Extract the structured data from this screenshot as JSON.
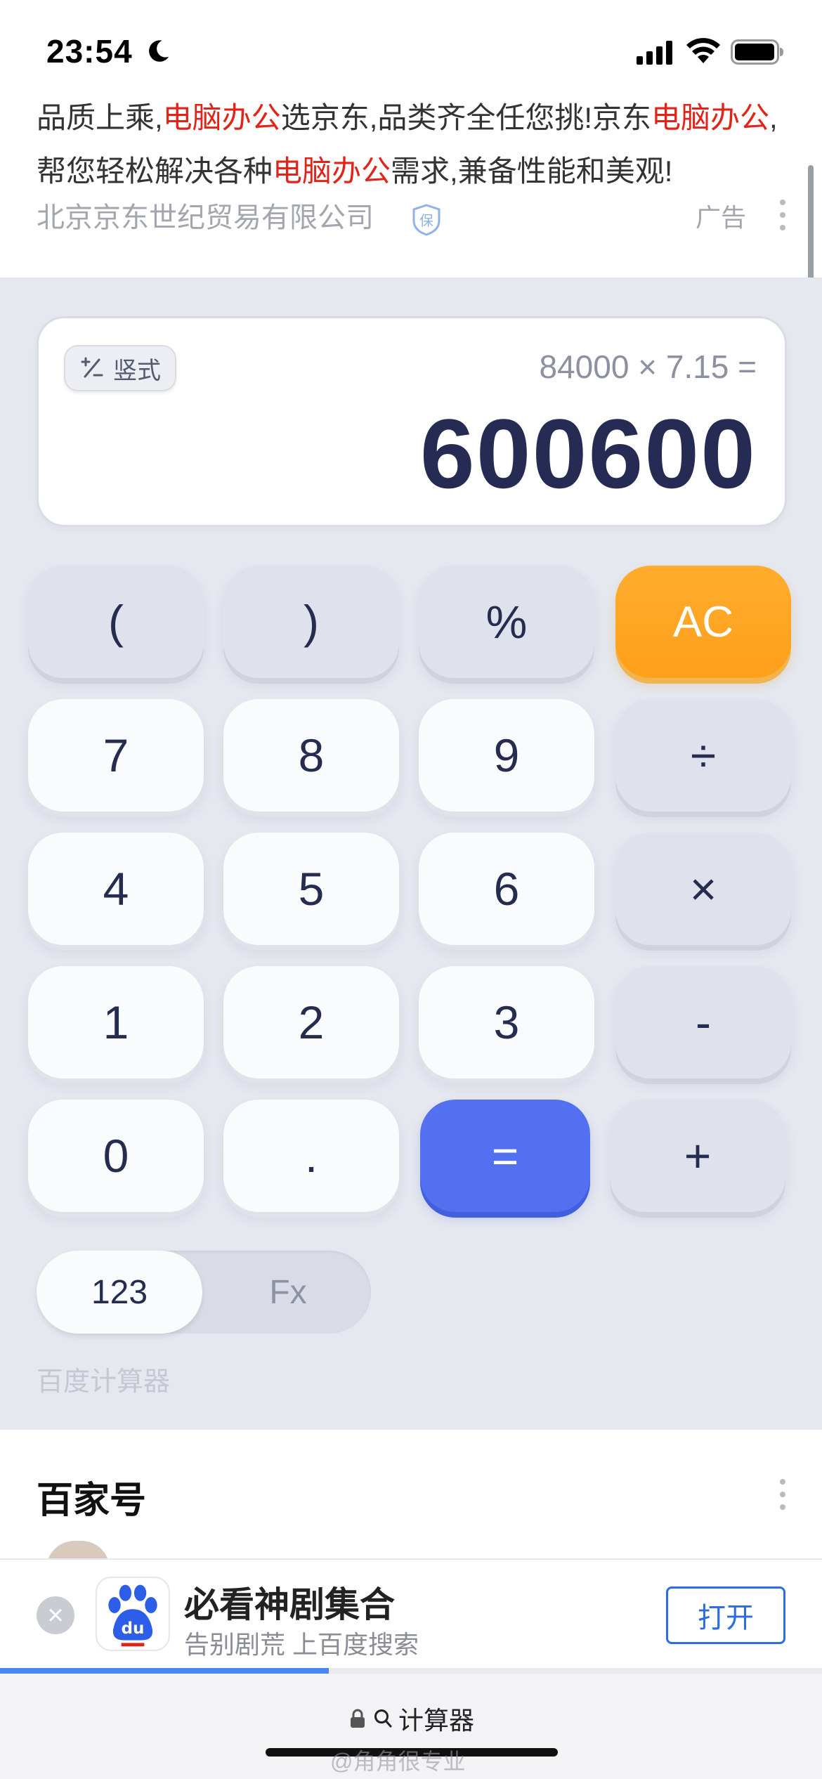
{
  "status_bar": {
    "time": "23:54",
    "icons": [
      "moon-icon",
      "signal-icon",
      "wifi-icon",
      "battery-icon"
    ]
  },
  "ad": {
    "text_parts": [
      {
        "text": "品质上乘,",
        "highlight": false
      },
      {
        "text": "电脑办公",
        "highlight": true
      },
      {
        "text": "选京东,品类齐全任您挑!京东",
        "highlight": false
      },
      {
        "text": "电脑办公",
        "highlight": true
      },
      {
        "text": ",帮您轻松解决各种",
        "highlight": false
      },
      {
        "text": "电脑办公",
        "highlight": true
      },
      {
        "text": "需求,兼备性能和美观!",
        "highlight": false
      }
    ],
    "company": "北京京东世纪贸易有限公司",
    "shield_char": "保",
    "label": "广告",
    "highlight_color": "#e2231a"
  },
  "calculator": {
    "mode_label": "竖式",
    "expression": "84000 × 7.15 =",
    "result": "600600",
    "keys": [
      {
        "label": "(",
        "name": "key-open-paren",
        "style": "gray"
      },
      {
        "label": ")",
        "name": "key-close-paren",
        "style": "gray"
      },
      {
        "label": "%",
        "name": "key-percent",
        "style": "gray"
      },
      {
        "label": "AC",
        "name": "key-clear",
        "style": "orange"
      },
      {
        "label": "7",
        "name": "key-7",
        "style": "light"
      },
      {
        "label": "8",
        "name": "key-8",
        "style": "light"
      },
      {
        "label": "9",
        "name": "key-9",
        "style": "light"
      },
      {
        "label": "÷",
        "name": "key-divide",
        "style": "gray"
      },
      {
        "label": "4",
        "name": "key-4",
        "style": "light"
      },
      {
        "label": "5",
        "name": "key-5",
        "style": "light"
      },
      {
        "label": "6",
        "name": "key-6",
        "style": "light"
      },
      {
        "label": "×",
        "name": "key-multiply",
        "style": "gray"
      },
      {
        "label": "1",
        "name": "key-1",
        "style": "light"
      },
      {
        "label": "2",
        "name": "key-2",
        "style": "light"
      },
      {
        "label": "3",
        "name": "key-3",
        "style": "light"
      },
      {
        "label": "-",
        "name": "key-minus",
        "style": "gray"
      },
      {
        "label": "0",
        "name": "key-0",
        "style": "light"
      },
      {
        "label": ".",
        "name": "key-decimal",
        "style": "light"
      },
      {
        "label": "=",
        "name": "key-equals",
        "style": "blue"
      },
      {
        "label": "+",
        "name": "key-plus",
        "style": "gray"
      }
    ],
    "toggle": {
      "active": "123",
      "inactive": "Fx"
    },
    "source": "百度计算器",
    "colors": {
      "accent_orange": "#ff9f1a",
      "accent_blue": "#5270f0",
      "result_text": "#252b52"
    }
  },
  "baijiahao": {
    "title": "百家号"
  },
  "app_banner": {
    "title": "必看神剧集合",
    "subtitle": "告别剧荒 上百度搜索",
    "open_label": "打开",
    "icon_text": "du",
    "progress": 0.4
  },
  "url_bar": {
    "query": "计算器",
    "watermark": "@角角很专业"
  }
}
